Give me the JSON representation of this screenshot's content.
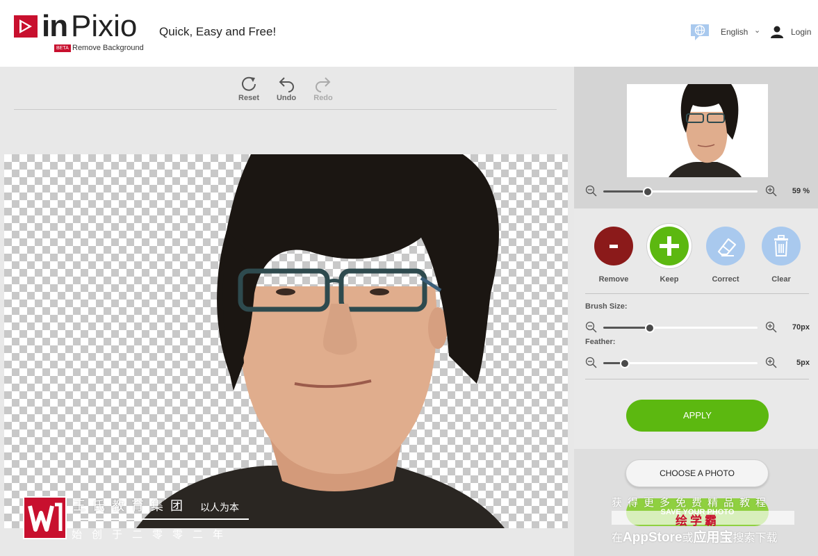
{
  "header": {
    "logo_in": "in",
    "logo_pixio": "Pixio",
    "logo_beta": "BETA",
    "logo_sub": "Remove Background",
    "tagline": "Quick, Easy and Free!",
    "language": "English",
    "login": "Login"
  },
  "toolbar": {
    "reset": "Reset",
    "undo": "Undo",
    "redo": "Redo"
  },
  "preview": {
    "zoom_value": "59 %",
    "zoom_level": 0.29
  },
  "modes": [
    {
      "label": "Remove",
      "symbol": "-",
      "color": "#8b1a1a"
    },
    {
      "label": "Keep",
      "symbol": "+",
      "color": "#5cb810"
    },
    {
      "label": "Correct",
      "symbol": "eraser-icon",
      "color": "#a9c9ee"
    },
    {
      "label": "Clear",
      "symbol": "trash-icon",
      "color": "#a9c9ee"
    }
  ],
  "brush": {
    "label": "Brush Size:",
    "value": "70px",
    "level": 0.3
  },
  "feather": {
    "label": "Feather:",
    "value": "5px",
    "level": 0.14
  },
  "buttons": {
    "apply": "APPLY",
    "choose": "CHOOSE A PHOTO",
    "save": "SAVE YOUR PHOTO"
  },
  "watermark": {
    "company": "王氏教育集团",
    "slogan": "以人为本",
    "founded": "始创于二零零二年",
    "promo_line": "获得更多免费精品教程",
    "brand": "绘学霸",
    "store_prefix": "在",
    "store_appstore": "AppStore",
    "store_or": "或",
    "store_yyb": "应用宝",
    "store_suffix": "搜索下载"
  },
  "colors": {
    "accent_red": "#c8102e",
    "apply_green": "#5cb810",
    "remove_red": "#8b1a1a",
    "soft_blue": "#a9c9ee"
  }
}
